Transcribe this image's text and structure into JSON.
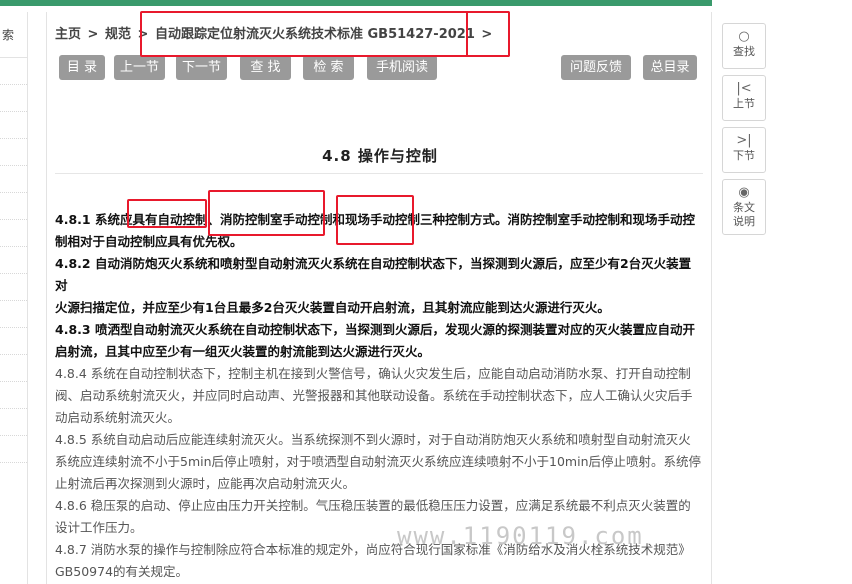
{
  "left_panel": {
    "search_label": "索"
  },
  "breadcrumb": {
    "home": "主页",
    "sep1": ">",
    "section": "规范",
    "sep2": ">",
    "current": "自动跟踪定位射流灭火系统技术标准 GB51427-2021",
    "sep3": ">"
  },
  "toolbar": {
    "toc": "目 录",
    "prev": "上一节",
    "next": "下一节",
    "find": "查 找",
    "search": "检 索",
    "mobile": "手机阅读",
    "feedback": "问题反馈",
    "full_toc": "总目录"
  },
  "section_title": "4.8 操作与控制",
  "paragraphs": [
    {
      "style": "bold",
      "lines": [
        "4.8.1 系统应具有自动控制、消防控制室手动控制和现场手动控制三种控制方式。消防控制室手动控制和现场手动控",
        "制相对于自动控制应具有优先权。"
      ]
    },
    {
      "style": "bold",
      "lines": [
        "4.8.2 自动消防炮灭火系统和喷射型自动射流灭火系统在自动控制状态下，当探测到火源后，应至少有2台灭火装置对",
        "火源扫描定位，并应至少有1台且最多2台灭火装置自动开启射流，且其射流应能到达火源进行灭火。"
      ]
    },
    {
      "style": "bold",
      "lines": [
        "4.8.3 喷洒型自动射流灭火系统在自动控制状态下，当探测到火源后，发现火源的探测装置对应的灭火装置应自动开",
        "启射流，且其中应至少有一组灭火装置的射流能到达火源进行灭火。"
      ]
    },
    {
      "style": "normal",
      "lines": [
        "4.8.4 系统在自动控制状态下，控制主机在接到火警信号，确认火灾发生后，应能自动启动消防水泵、打开自动控制",
        "阀、启动系统射流灭火，并应同时启动声、光警报器和其他联动设备。系统在手动控制状态下，应人工确认火灾后手",
        "动启动系统射流灭火。"
      ]
    },
    {
      "style": "normal",
      "lines": [
        "4.8.5 系统自动启动后应能连续射流灭火。当系统探测不到火源时，对于自动消防炮灭火系统和喷射型自动射流灭火",
        "系统应连续射流不小于5min后停止喷射，对于喷洒型自动射流灭火系统应连续喷射不小于10min后停止喷射。系统停",
        "止射流后再次探测到火源时，应能再次启动射流灭火。"
      ]
    },
    {
      "style": "normal",
      "lines": [
        "4.8.6 稳压泵的启动、停止应由压力开关控制。气压稳压装置的最低稳压压力设置，应满足系统最不利点灭火装置的",
        "设计工作压力。"
      ]
    },
    {
      "style": "normal",
      "lines": [
        "4.8.7 消防水泵的操作与控制除应符合本标准的规定外，尚应符合现行国家标准《消防给水及消火栓系统技术规范》",
        "GB50974的有关规定。"
      ]
    }
  ],
  "watermark": "www.1190119.com",
  "right_tools": [
    {
      "icon": "search-icon",
      "glyph": "○",
      "label": "查找"
    },
    {
      "icon": "prev-section-icon",
      "glyph": "|<",
      "label": "上节"
    },
    {
      "icon": "next-section-icon",
      "glyph": ">|",
      "label": "下节"
    },
    {
      "icon": "eye-icon",
      "glyph": "◉",
      "label": "条文说明"
    }
  ],
  "colors": {
    "topbar": "#3a9a6c",
    "highlight": "#e8192c",
    "button": "#9a9a9a"
  }
}
